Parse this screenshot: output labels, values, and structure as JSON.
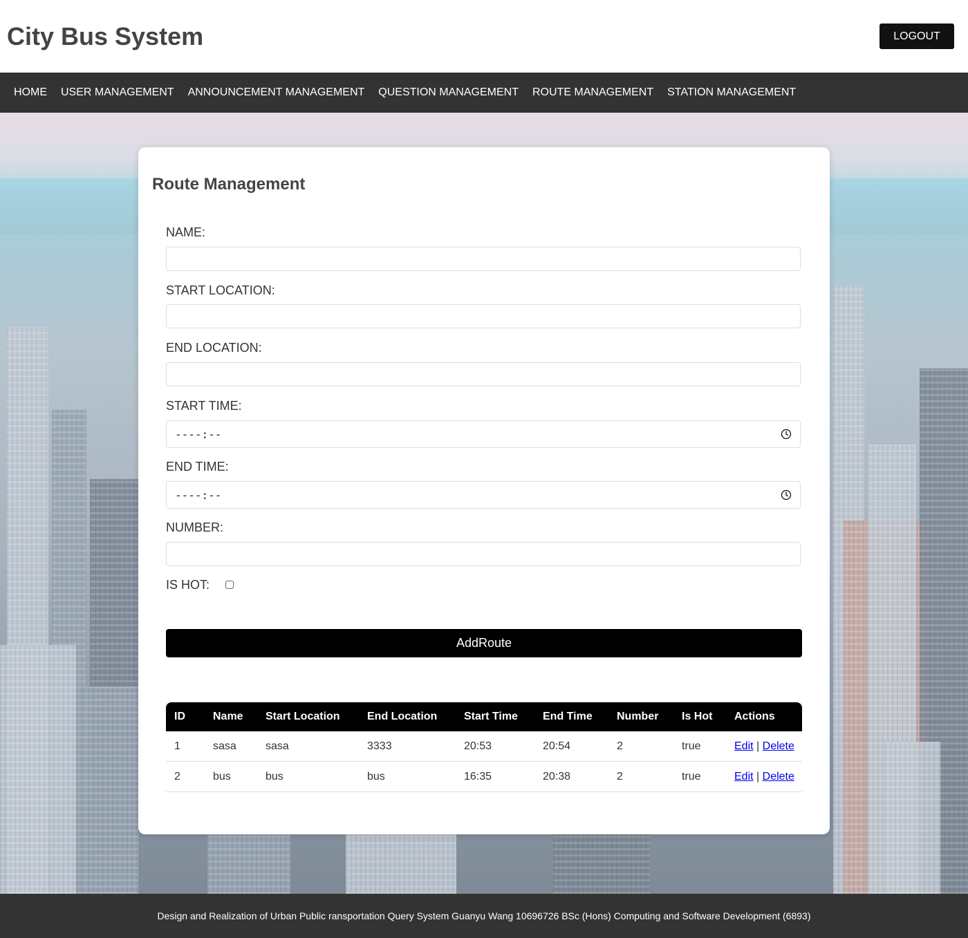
{
  "header": {
    "title": "City Bus System",
    "logout_label": "LOGOUT"
  },
  "nav": {
    "items": [
      {
        "label": "HOME"
      },
      {
        "label": "USER MANAGEMENT"
      },
      {
        "label": "ANNOUNCEMENT MANAGEMENT"
      },
      {
        "label": "QUESTION MANAGEMENT"
      },
      {
        "label": "ROUTE MANAGEMENT"
      },
      {
        "label": "STATION MANAGEMENT"
      }
    ]
  },
  "form": {
    "title": "Route Management",
    "name_label": "NAME:",
    "name_value": "",
    "start_location_label": "START LOCATION:",
    "start_location_value": "",
    "end_location_label": "END LOCATION:",
    "end_location_value": "",
    "start_time_label": "START TIME:",
    "start_time_placeholder": "----:--",
    "end_time_label": "END TIME:",
    "end_time_placeholder": "----:--",
    "number_label": "NUMBER:",
    "number_value": "",
    "is_hot_label": "IS HOT:",
    "is_hot_checked": false,
    "submit_label": "AddRoute"
  },
  "table": {
    "columns": [
      "ID",
      "Name",
      "Start Location",
      "End Location",
      "Start Time",
      "End Time",
      "Number",
      "Is Hot",
      "Actions"
    ],
    "edit_label": "Edit",
    "separator": "|",
    "delete_label": "Delete",
    "rows": [
      {
        "id": "1",
        "name": "sasa",
        "start_location": "sasa",
        "end_location": "3333",
        "start_time": "20:53",
        "end_time": "20:54",
        "number": "2",
        "is_hot": "true"
      },
      {
        "id": "2",
        "name": "bus",
        "start_location": "bus",
        "end_location": "bus",
        "start_time": "16:35",
        "end_time": "20:38",
        "number": "2",
        "is_hot": "true"
      }
    ]
  },
  "footer": {
    "text": "Design and Realization of Urban Public ransportation Query System Guanyu Wang 10696726 BSc (Hons) Computing and Software Development (6893)"
  },
  "icons": {
    "time_field_icon": "clock-icon"
  }
}
